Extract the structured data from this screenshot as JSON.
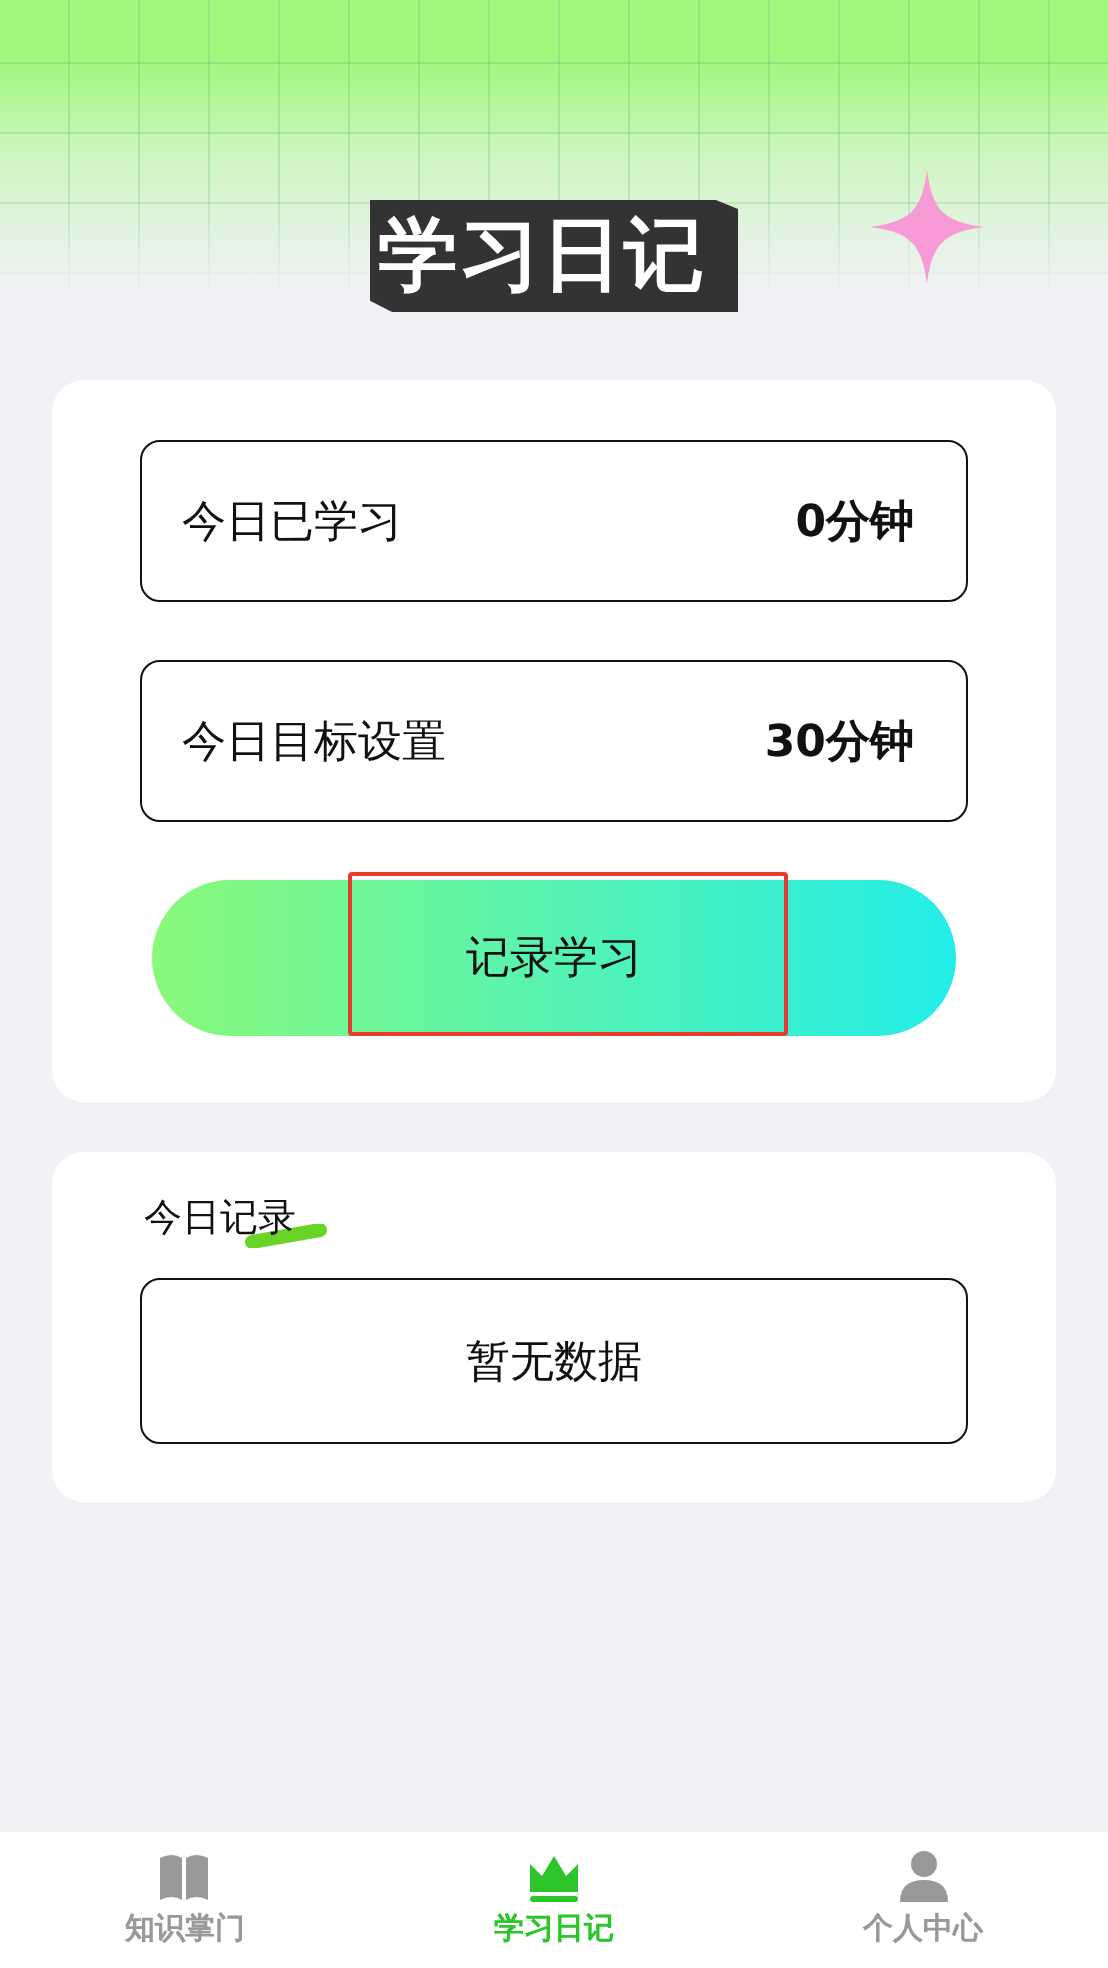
{
  "header": {
    "title": "学习日记"
  },
  "stats": [
    {
      "label": "今日已学习",
      "value": "0分钟"
    },
    {
      "label": "今日目标设置",
      "value": "30分钟"
    }
  ],
  "record_button": {
    "label": "记录学习",
    "highlighted": true
  },
  "today_records": {
    "title": "今日记录",
    "empty_text": "暂无数据"
  },
  "tab_bar": [
    {
      "label": "知识掌门",
      "selected": false
    },
    {
      "label": "学习日记",
      "selected": true
    },
    {
      "label": "个人中心",
      "selected": false
    }
  ]
}
